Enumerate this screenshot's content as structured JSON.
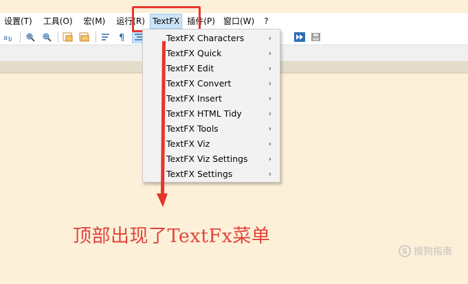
{
  "menubar": {
    "items": [
      {
        "label": "设置(T)"
      },
      {
        "label": "工具(O)"
      },
      {
        "label": "宏(M)"
      },
      {
        "label": "运行(R)"
      },
      {
        "label": "TextFX"
      },
      {
        "label": "插件(P)"
      },
      {
        "label": "窗口(W)"
      },
      {
        "label": "?"
      }
    ]
  },
  "toolbar": {
    "icons": [
      "sync-icon",
      "zoom-in-icon",
      "zoom-out-icon",
      "window-icon",
      "window-alt-icon",
      "wrap-icon",
      "pilcrow-icon",
      "indent-icon",
      "macro-play-icon",
      "macro-save-icon"
    ]
  },
  "dropdown": {
    "items": [
      {
        "label": "TextFX Characters",
        "arrow": "›"
      },
      {
        "label": "TextFX Quick",
        "arrow": "›"
      },
      {
        "label": "TextFX Edit",
        "arrow": "›"
      },
      {
        "label": "TextFX Convert",
        "arrow": "›"
      },
      {
        "label": "TextFX Insert",
        "arrow": "›"
      },
      {
        "label": "TextFX HTML Tidy",
        "arrow": "›"
      },
      {
        "label": "TextFX Tools",
        "arrow": "›"
      },
      {
        "label": "TextFX Viz",
        "arrow": "›"
      },
      {
        "label": "TextFX Viz Settings",
        "arrow": "›"
      },
      {
        "label": "TextFX Settings",
        "arrow": "›"
      }
    ]
  },
  "annotation": {
    "caption": "顶部出现了TextFx菜单"
  },
  "watermark": {
    "badge": "S",
    "text": "搜狗指南"
  },
  "colors": {
    "editor_background": "#fdf0d8",
    "highlight": "#e8342c",
    "menu_active": "#cce4f7"
  }
}
